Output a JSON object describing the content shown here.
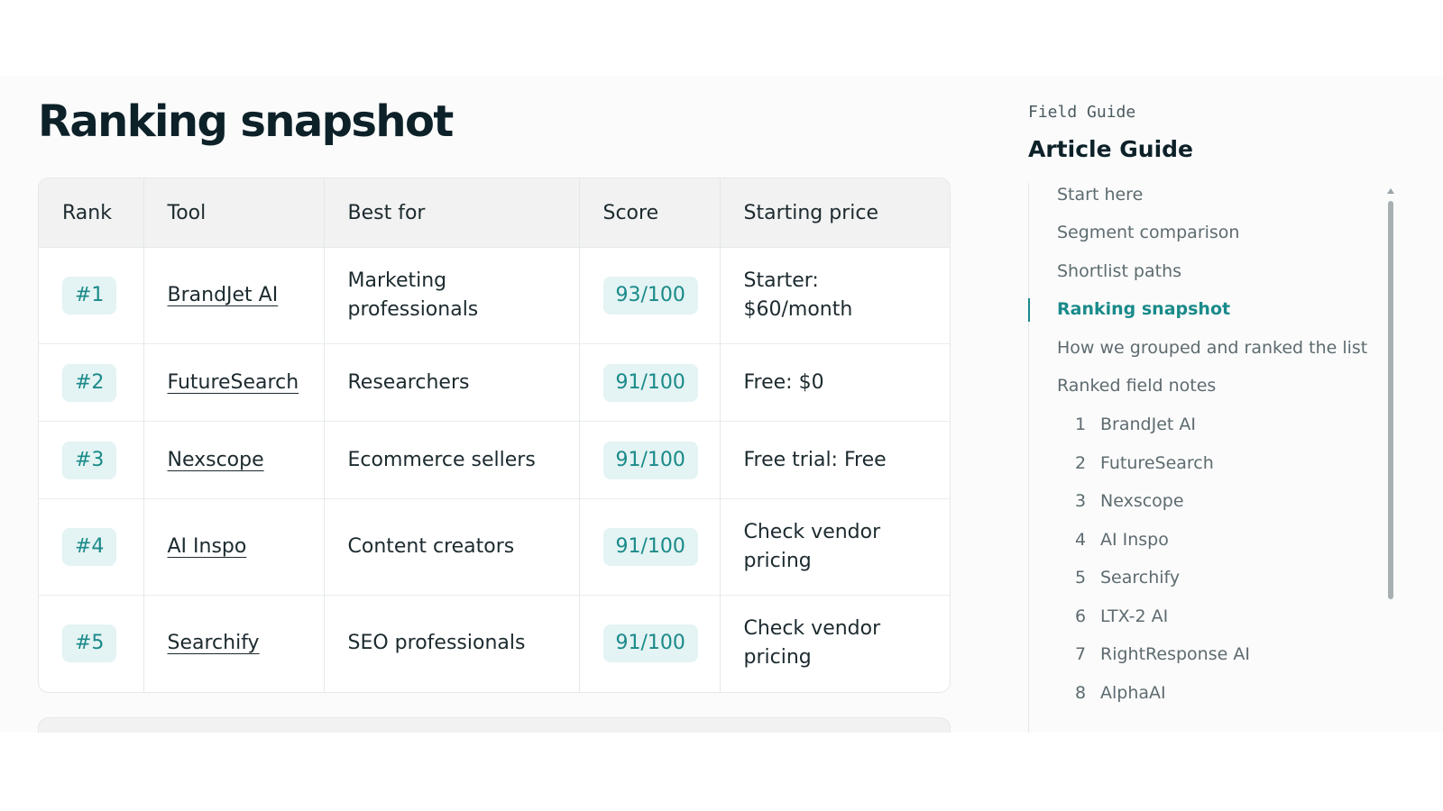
{
  "main": {
    "title": "Ranking snapshot",
    "table": {
      "headers": [
        "Rank",
        "Tool",
        "Best for",
        "Score",
        "Starting price"
      ],
      "rows": [
        {
          "rank": "#1",
          "tool": "BrandJet AI",
          "best_for": "Marketing professionals",
          "score": "93/100",
          "price": "Starter: $60/month"
        },
        {
          "rank": "#2",
          "tool": "FutureSearch",
          "best_for": "Researchers",
          "score": "91/100",
          "price": "Free: $0"
        },
        {
          "rank": "#3",
          "tool": "Nexscope",
          "best_for": "Ecommerce sellers",
          "score": "91/100",
          "price": "Free trial: Free"
        },
        {
          "rank": "#4",
          "tool": "AI Inspo",
          "best_for": "Content creators",
          "score": "91/100",
          "price": "Check vendor pricing"
        },
        {
          "rank": "#5",
          "tool": "Searchify",
          "best_for": "SEO professionals",
          "score": "91/100",
          "price": "Check vendor pricing"
        }
      ]
    }
  },
  "sidebar": {
    "eyebrow": "Field Guide",
    "title": "Article Guide",
    "items": [
      {
        "label": "Start here"
      },
      {
        "label": "Segment comparison"
      },
      {
        "label": "Shortlist paths"
      },
      {
        "label": "Ranking snapshot",
        "active": true
      },
      {
        "label": "How we grouped and ranked the list"
      },
      {
        "label": "Ranked field notes"
      }
    ],
    "subitems": [
      {
        "num": "1",
        "label": "BrandJet AI"
      },
      {
        "num": "2",
        "label": "FutureSearch"
      },
      {
        "num": "3",
        "label": "Nexscope"
      },
      {
        "num": "4",
        "label": "AI Inspo"
      },
      {
        "num": "5",
        "label": "Searchify"
      },
      {
        "num": "6",
        "label": "LTX-2 AI"
      },
      {
        "num": "7",
        "label": "RightResponse AI"
      },
      {
        "num": "8",
        "label": "AlphaAI"
      }
    ]
  },
  "colors": {
    "accent": "#1a8a8a",
    "pill_bg": "#e4f3f3",
    "heading": "#0d2129",
    "muted_text": "#5d6b70"
  }
}
